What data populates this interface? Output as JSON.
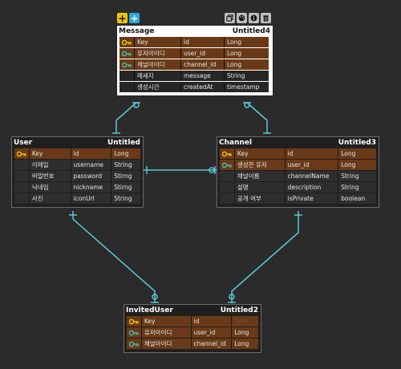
{
  "toolbar": {
    "add_labels": [
      "+",
      "+"
    ],
    "icons": [
      "copy-icon",
      "palette-icon",
      "info-icon",
      "trash-icon"
    ]
  },
  "colors": {
    "background": "#2b2b2b",
    "key_row": "#6a3a18",
    "key_icon": "#f0c400",
    "fk_icon": "#3fbfb0",
    "link": "#5bc8d4"
  },
  "tables": {
    "message": {
      "name": "Message",
      "label": "Untitled4",
      "rows": [
        {
          "kind": "pk",
          "icon": "key-icon",
          "name": "Key",
          "field": "id",
          "type": "Long"
        },
        {
          "kind": "fk",
          "icon": "foreign-key-icon",
          "name": "유저아이디",
          "field": "user_id",
          "type": "Long"
        },
        {
          "kind": "fk",
          "icon": "foreign-key-icon",
          "name": "채널아이디",
          "field": "channel_id",
          "type": "Long"
        },
        {
          "kind": "plain",
          "icon": "",
          "name": "메세지",
          "field": "message",
          "type": "String"
        },
        {
          "kind": "plain",
          "icon": "",
          "name": "생성시간",
          "field": "createdAt",
          "type": "timestamp"
        }
      ]
    },
    "user": {
      "name": "User",
      "label": "Untitled",
      "rows": [
        {
          "kind": "pk",
          "icon": "key-icon",
          "name": "Key",
          "field": "id",
          "type": "Long"
        },
        {
          "kind": "plain",
          "icon": "",
          "name": "이메일",
          "field": "username",
          "type": "String"
        },
        {
          "kind": "plain",
          "icon": "",
          "name": "비밀번호",
          "field": "password",
          "type": "Stirng"
        },
        {
          "kind": "plain",
          "icon": "",
          "name": "닉네임",
          "field": "nickname",
          "type": "Stirng"
        },
        {
          "kind": "plain",
          "icon": "",
          "name": "사진",
          "field": "iconUrl",
          "type": "String"
        }
      ]
    },
    "channel": {
      "name": "Channel",
      "label": "Untitled3",
      "rows": [
        {
          "kind": "pk",
          "icon": "key-icon",
          "name": "Key",
          "field": "id",
          "type": "Long"
        },
        {
          "kind": "fk",
          "icon": "foreign-key-icon",
          "name": "생성한 유저",
          "field": "user_id",
          "type": "Long"
        },
        {
          "kind": "plain",
          "icon": "",
          "name": "채널이름",
          "field": "channelName",
          "type": "String"
        },
        {
          "kind": "plain",
          "icon": "",
          "name": "설명",
          "field": "description",
          "type": "String"
        },
        {
          "kind": "plain",
          "icon": "",
          "name": "공개 여부",
          "field": "isPrivate",
          "type": "boolean"
        }
      ]
    },
    "invited": {
      "name": "InvitedUser",
      "label": "Untitled2",
      "rows": [
        {
          "kind": "pk",
          "icon": "key-icon",
          "name": "Key",
          "field": "id",
          "type": "Type"
        },
        {
          "kind": "fk",
          "icon": "foreign-key-icon",
          "name": "유저아이디",
          "field": "user_id",
          "type": "Long"
        },
        {
          "kind": "fk",
          "icon": "foreign-key-icon",
          "name": "채널아이디",
          "field": "channel_id",
          "type": "Long"
        }
      ]
    }
  }
}
